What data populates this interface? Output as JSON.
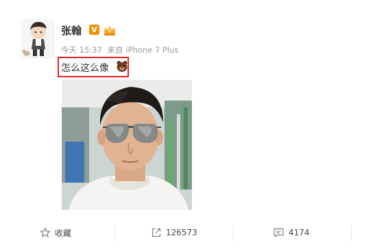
{
  "post": {
    "author": "张翰",
    "verified_badge": "V",
    "time": "今天 15:37",
    "source_prefix": "来自",
    "source": "iPhone 7 Plus",
    "text": "怎么这么像"
  },
  "actions": {
    "favorite_label": "收藏",
    "forward_count": "126573",
    "comment_count": "4174"
  },
  "colors": {
    "highlight_box": "#e02020",
    "verified": "#f29100",
    "meta_text": "#999999"
  }
}
